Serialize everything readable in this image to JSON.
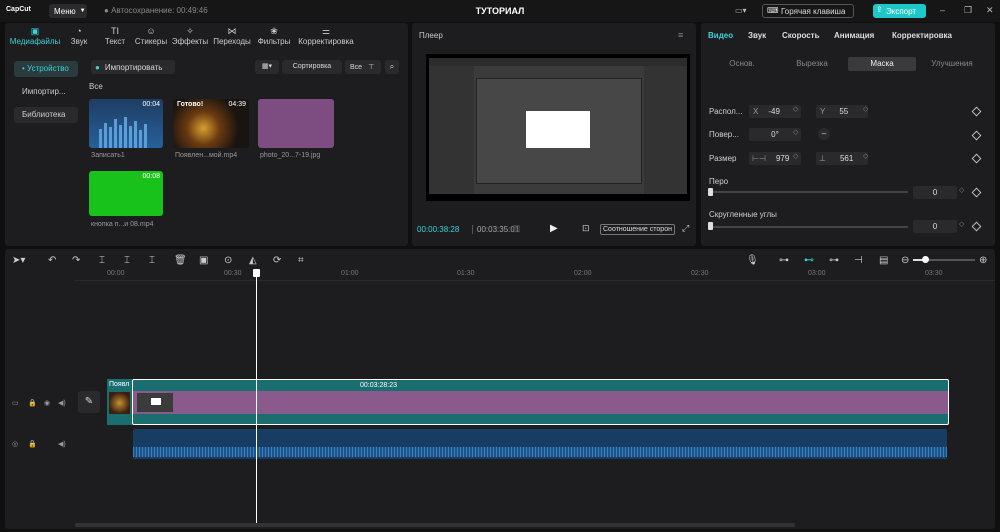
{
  "app": {
    "logo": "CapCut",
    "menu": "Меню",
    "autosave": "Автосохранение: 00:49:46",
    "title": "ТУТОРИАЛ",
    "hotkey": "Горячая клавиша",
    "export": "Экспорт"
  },
  "top_tabs": [
    {
      "label": "Медиафайлы",
      "icon": "media-icon"
    },
    {
      "label": "Звук",
      "icon": "audio-icon"
    },
    {
      "label": "Текст",
      "icon": "text-icon"
    },
    {
      "label": "Стикеры",
      "icon": "sticker-icon"
    },
    {
      "label": "Эффекты",
      "icon": "effects-icon"
    },
    {
      "label": "Переходы",
      "icon": "transitions-icon"
    },
    {
      "label": "Фильтры",
      "icon": "filters-icon"
    },
    {
      "label": "Корректировка",
      "icon": "adjust-icon"
    }
  ],
  "media_sidebar": [
    "• Устройство",
    "Импортир...",
    "Библиотека"
  ],
  "media": {
    "import": "Импортировать",
    "sort": "Сортировка",
    "filter": "Все",
    "all_label": "Все",
    "items": [
      {
        "name": "Записать1",
        "duration": "00:04"
      },
      {
        "name": "Появлен...мой.mp4",
        "duration": "04:39",
        "badge": "Готово!"
      },
      {
        "name": "photo_20...7-19.jpg",
        "duration": ""
      },
      {
        "name": "кнопка п...и 08.mp4",
        "duration": "00:08"
      }
    ]
  },
  "player": {
    "title": "Плеер",
    "current": "00:00:38:28",
    "total": "00:03:35:01",
    "ratio": "Соотношение сторон"
  },
  "props": {
    "tabs": [
      "Видео",
      "Звук",
      "Скорость",
      "Анимация",
      "Корректировка"
    ],
    "sub_tabs": [
      "Основ.",
      "Вырезка",
      "Маска",
      "Улучшения"
    ],
    "position_label": "Распол...",
    "x_label": "X",
    "x_value": "-49",
    "y_label": "Y",
    "y_value": "55",
    "rotate_label": "Повер...",
    "rotate_value": "0°",
    "rotate_extra": "–",
    "size_label": "Размер",
    "width_value": "979",
    "height_value": "561",
    "feather_label": "Перо",
    "feather_value": "0",
    "round_label": "Скругленные углы",
    "round_value": "0"
  },
  "timeline": {
    "ruler": [
      "00:00",
      "00:30",
      "01:00",
      "01:30",
      "02:00",
      "02:30",
      "03:00",
      "03:30"
    ],
    "clip_name": "Появл",
    "clip_duration": "00:03:28:23"
  },
  "colors": {
    "accent": "#3ad3d8",
    "export": "#1fc8c8",
    "clip_teal": "#1a6e70",
    "clip_purple": "#8a5a8d",
    "audio": "#173d63"
  }
}
